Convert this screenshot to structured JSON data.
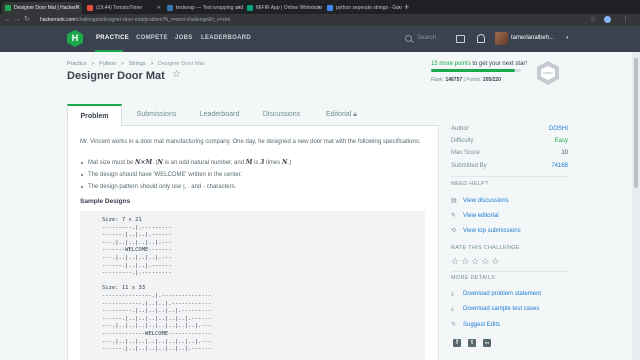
{
  "browser": {
    "tabs": [
      {
        "label": "Designer Door Mat | HackerR",
        "color": "#1ba94c",
        "active": true
      },
      {
        "label": "(19:44) TomatoTimer",
        "color": "#e74c3c",
        "active": false
      },
      {
        "label": "textwrap — Text wrapping and",
        "color": "#3776ab",
        "active": false
      },
      {
        "label": "MIFIR App | Online Whiteboar",
        "color": "#00a67e",
        "active": false
      },
      {
        "label": "python seperate strings - Goo",
        "color": "#4285f4",
        "active": false
      }
    ],
    "new_tab": "+",
    "url_host": "hackerrank.com",
    "url_path": "/challenges/designer-door-mat/problem?h_r=next-challenge&h_v=zen"
  },
  "header": {
    "logo": "H",
    "nav": [
      "PRACTICE",
      "COMPETE",
      "JOBS",
      "LEADERBOARD"
    ],
    "search_placeholder": "Search",
    "username": "tamerlanalbeh..."
  },
  "breadcrumbs": [
    "Practice",
    ">",
    "Python",
    ">",
    "Strings",
    ">",
    "Designer Door Mat"
  ],
  "title": "Designer Door Mat",
  "progress": {
    "points_green": "15 more points",
    "points_rest": " to get your next star!",
    "fill_pct": 0.93,
    "rank_label": "Rank: ",
    "rank_value": "146757",
    "separator": "|",
    "points_label": "Points: ",
    "points_value": "205/220"
  },
  "badge_text": "Python",
  "tabs": [
    "Problem",
    "Submissions",
    "Leaderboard",
    "Discussions",
    "Editorial"
  ],
  "problem": {
    "description": "Mr. Vincent works in a door mat manufacturing company. One day, he designed a new door mat with the following specifications:",
    "bullet1_a": "Mat size must be ",
    "bullet1_m1": "N",
    "bullet1_x": "×",
    "bullet1_m2": "M",
    "bullet1_b": ". (",
    "bullet1_m3": "N",
    "bullet1_c": " is an odd natural number, and ",
    "bullet1_m4": "M",
    "bullet1_d": " is ",
    "bullet1_m5": "3",
    "bullet1_e": " times ",
    "bullet1_m6": "N",
    "bullet1_f": ".)",
    "bullet2": "The design should have 'WELCOME' written in the center.",
    "bullet3": "The design pattern should only use |, . and - characters.",
    "sample_head": "Sample Designs",
    "code": "Size: 7 x 21\n---------.|.---------\n------.|..|..|.------\n---.|..|..|..|..|.---\n-------WELCOME-------\n---.|..|..|..|..|.---\n------.|..|..|.------\n---------.|.---------\n\nSize: 11 x 33\n---------------.|.---------------\n------------.|..|..|.------------\n---------.|..|..|..|..|.---------\n------.|..|..|..|..|..|..|.------\n---.|..|..|..|..|..|..|..|..|.---\n-------------WELCOME-------------\n---.|..|..|..|..|..|..|..|..|.---\n------.|..|..|..|..|..|..|.------"
  },
  "sidebar": {
    "rows": [
      {
        "label": "Author",
        "value": "DOSHI"
      },
      {
        "label": "Difficulty",
        "value": "Easy"
      },
      {
        "label": "Max Score",
        "value": "10"
      },
      {
        "label": "Submitted By",
        "value": "74168"
      }
    ],
    "need_help": "NEED HELP?",
    "help_links": [
      "View discussions",
      "View editorial",
      "View top submissions"
    ],
    "rate_head": "RATE THIS CHALLENGE",
    "stars": [
      "☆",
      "☆",
      "☆",
      "☆",
      "☆"
    ],
    "more_head": "MORE DETAILS",
    "detail_links": [
      "Download problem statement",
      "Download sample test cases",
      "Suggest Edits"
    ],
    "social": [
      "f",
      "t",
      "in"
    ]
  }
}
